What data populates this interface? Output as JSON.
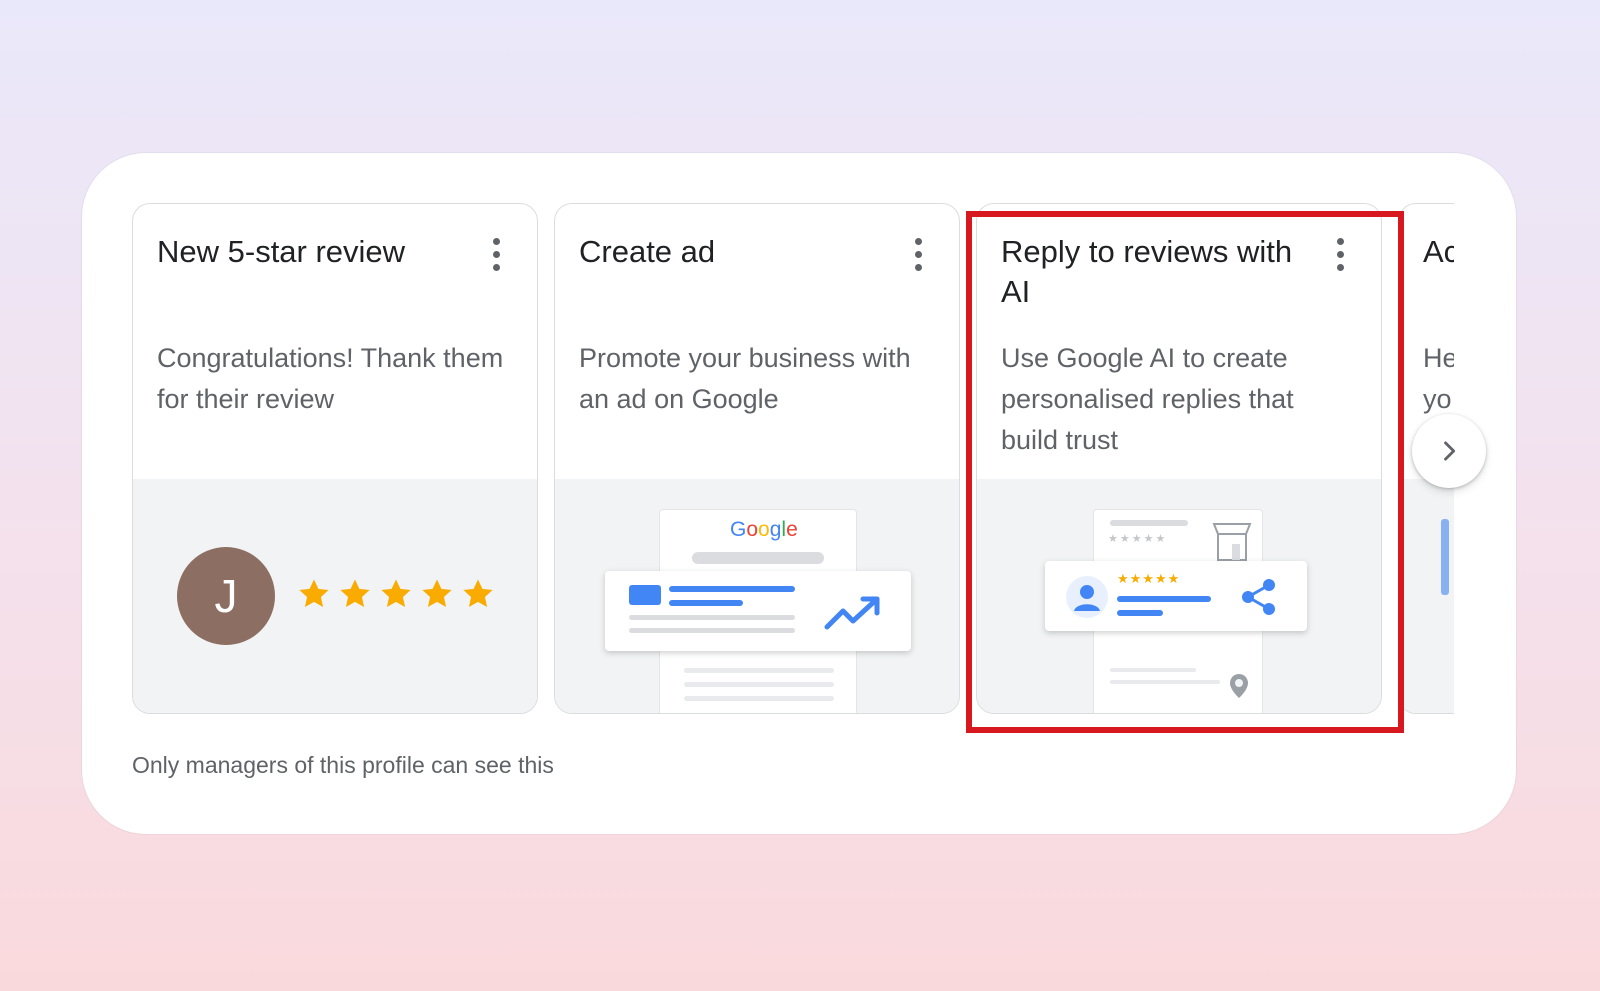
{
  "cards": [
    {
      "title": "New 5-star review",
      "description": "Congratulations! Thank them for their review",
      "avatar_initial": "J",
      "rating": 5
    },
    {
      "title": "Create ad",
      "description": "Promote your business with an ad on Google",
      "logo_text": [
        "G",
        "o",
        "o",
        "g",
        "l",
        "e"
      ]
    },
    {
      "title": "Reply to reviews with AI",
      "description": "Use Google AI to create personalised replies that build trust",
      "mini_rating_text": "★★★★★",
      "faded_rating_text": "★★★★★"
    },
    {
      "title": "Ac",
      "description": "He yo"
    }
  ],
  "footer_note": "Only managers of this profile can see this",
  "icons": {
    "menu": "more-vert-icon",
    "next": "chevron-right-icon",
    "star": "star-icon",
    "trend": "trending-up-icon",
    "share": "share-icon",
    "person": "person-icon",
    "store": "storefront-icon",
    "pin": "map-pin-icon"
  },
  "colors": {
    "star": "#f9ab00",
    "google_blue": "#4285f4",
    "google_red": "#ea4335",
    "google_yellow": "#fbbc05",
    "google_green": "#34a853",
    "avatar": "#8d6e63",
    "highlight": "#d7191f"
  }
}
